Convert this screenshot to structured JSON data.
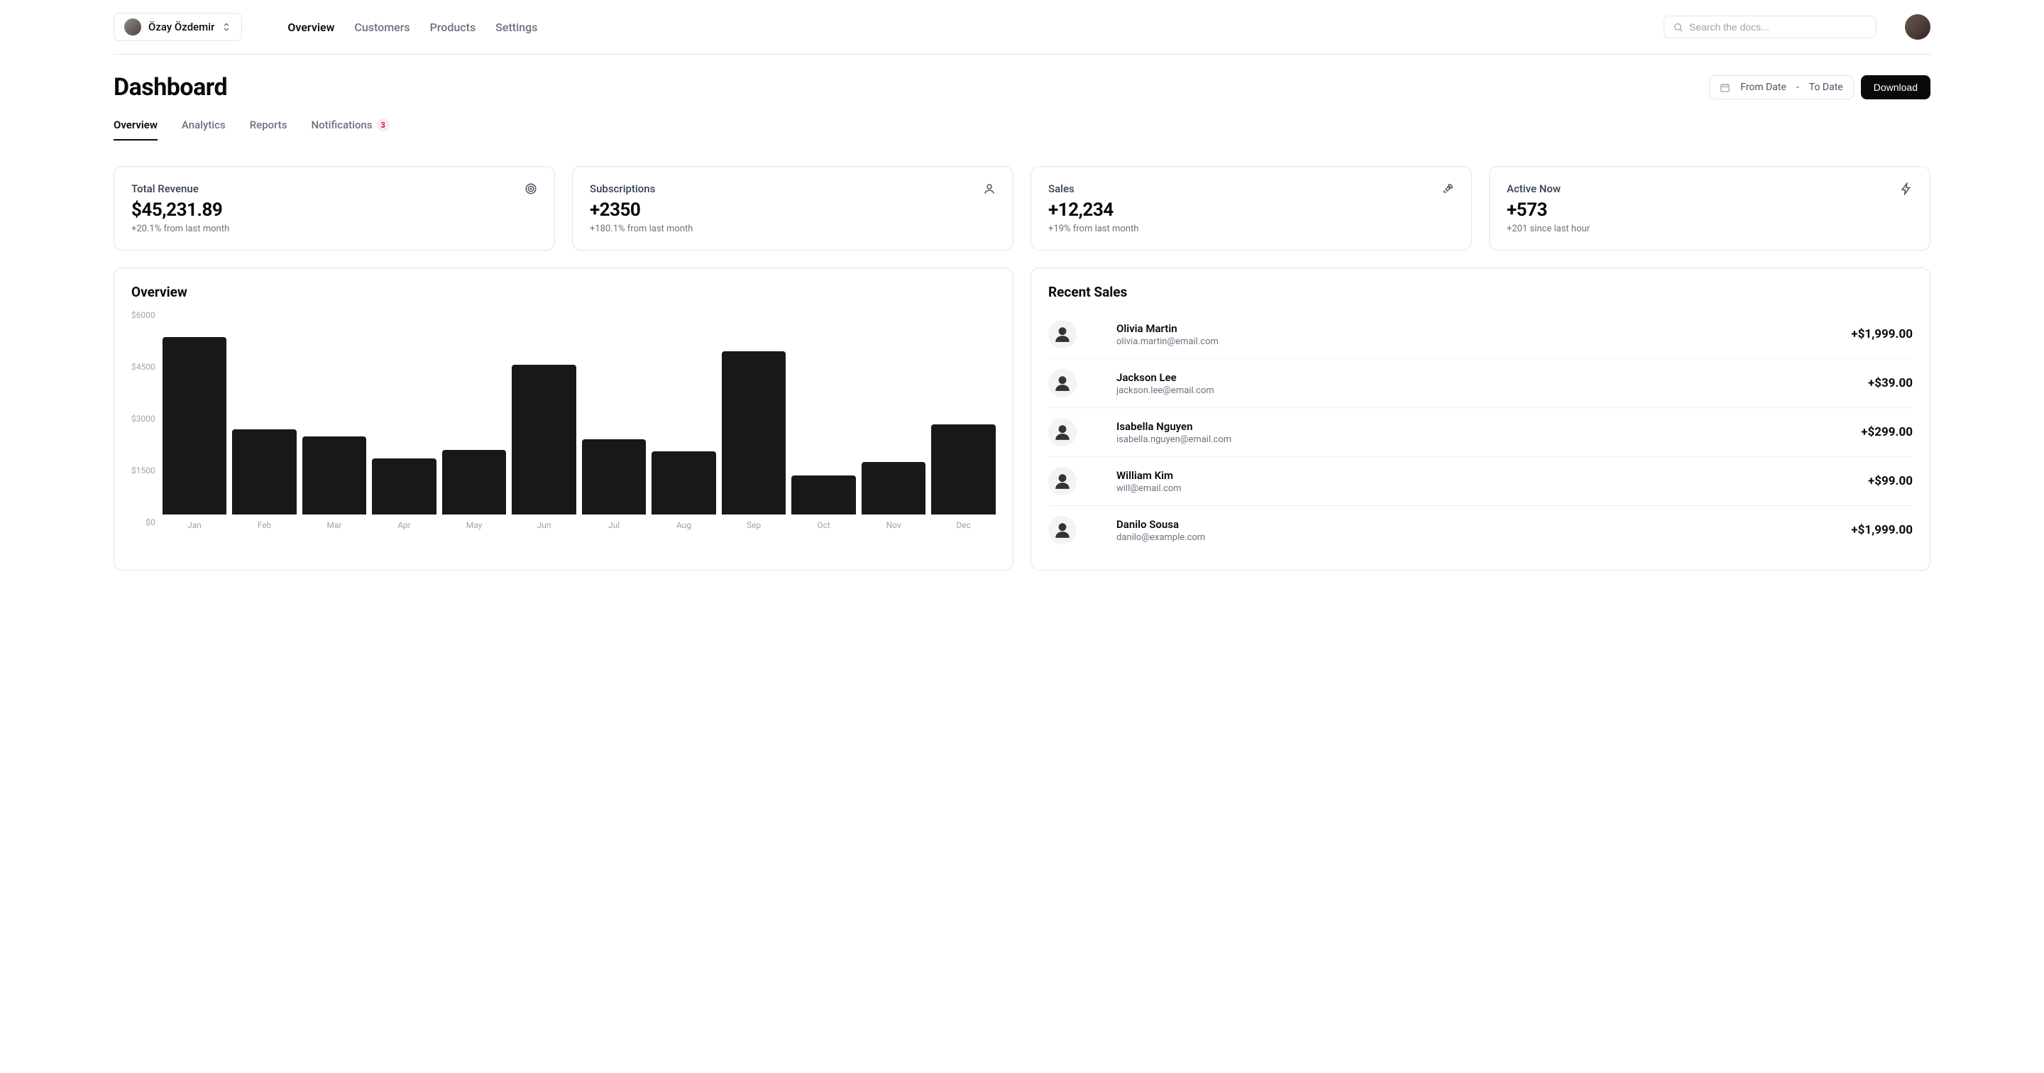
{
  "header": {
    "team_name": "Özay Özdemir",
    "nav": [
      "Overview",
      "Customers",
      "Products",
      "Settings"
    ],
    "active_nav_index": 0,
    "search_placeholder": "Search the docs..."
  },
  "page": {
    "title": "Dashboard",
    "date_from_label": "From Date",
    "date_to_label": "To Date",
    "download_label": "Download"
  },
  "tabs": {
    "items": [
      "Overview",
      "Analytics",
      "Reports",
      "Notifications"
    ],
    "active_index": 0,
    "notifications_badge": "3"
  },
  "stats": [
    {
      "label": "Total Revenue",
      "value": "$45,231.89",
      "sub": "+20.1% from last month",
      "icon": "target"
    },
    {
      "label": "Subscriptions",
      "value": "+2350",
      "sub": "+180.1% from last month",
      "icon": "user"
    },
    {
      "label": "Sales",
      "value": "+12,234",
      "sub": "+19% from last month",
      "icon": "rocket"
    },
    {
      "label": "Active Now",
      "value": "+573",
      "sub": "+201 since last hour",
      "icon": "zap"
    }
  ],
  "overview_panel_title": "Overview",
  "recent_title": "Recent Sales",
  "recent_sales": [
    {
      "name": "Olivia Martin",
      "email": "olivia.martin@email.com",
      "amount": "+$1,999.00"
    },
    {
      "name": "Jackson Lee",
      "email": "jackson.lee@email.com",
      "amount": "+$39.00"
    },
    {
      "name": "Isabella Nguyen",
      "email": "isabella.nguyen@email.com",
      "amount": "+$299.00"
    },
    {
      "name": "William Kim",
      "email": "will@email.com",
      "amount": "+$99.00"
    },
    {
      "name": "Danilo Sousa",
      "email": "danilo@example.com",
      "amount": "+$1,999.00"
    }
  ],
  "chart_data": {
    "type": "bar",
    "categories": [
      "Jan",
      "Feb",
      "Mar",
      "Apr",
      "May",
      "Jun",
      "Jul",
      "Aug",
      "Sep",
      "Oct",
      "Nov",
      "Dec"
    ],
    "values": [
      5200,
      2500,
      2300,
      1650,
      1900,
      4400,
      2200,
      1850,
      4800,
      1150,
      1550,
      2650
    ],
    "y_ticks": [
      "$6000",
      "$4500",
      "$3000",
      "$1500",
      "$0"
    ],
    "title": "Overview",
    "xlabel": "",
    "ylabel": "",
    "ylim": [
      0,
      6000
    ]
  }
}
